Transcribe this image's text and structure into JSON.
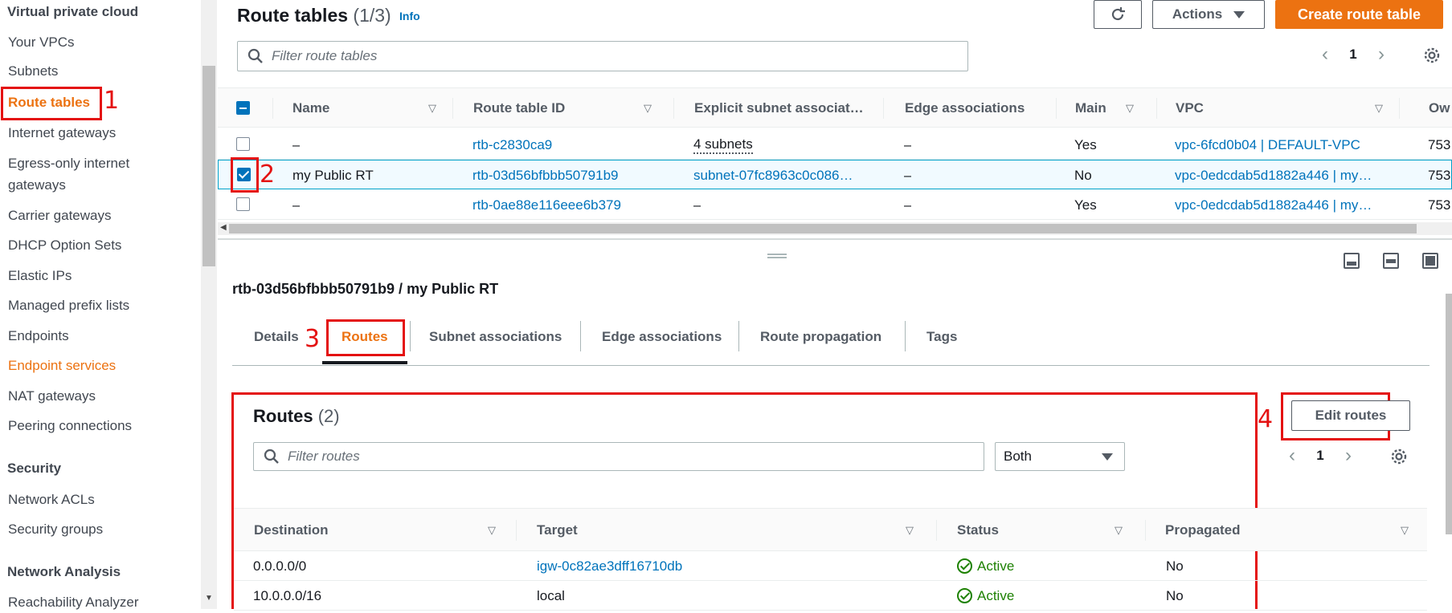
{
  "sidebar": {
    "section_vpc": "Virtual private cloud",
    "items": [
      {
        "label": "Your VPCs"
      },
      {
        "label": "Subnets"
      },
      {
        "label": "Route tables"
      },
      {
        "label": "Internet gateways"
      },
      {
        "label": "Egress-only internet"
      },
      {
        "label": "gateways"
      },
      {
        "label": "Carrier gateways"
      },
      {
        "label": "DHCP Option Sets"
      },
      {
        "label": "Elastic IPs"
      },
      {
        "label": "Managed prefix lists"
      },
      {
        "label": "Endpoints"
      },
      {
        "label": "Endpoint services"
      },
      {
        "label": "NAT gateways"
      },
      {
        "label": "Peering connections"
      }
    ],
    "section_security": "Security",
    "security_items": [
      {
        "label": "Network ACLs"
      },
      {
        "label": "Security groups"
      }
    ],
    "section_analysis": "Network Analysis",
    "analysis_items": [
      {
        "label": "Reachability Analyzer"
      }
    ]
  },
  "annotations": [
    "1",
    "2",
    "3",
    "4"
  ],
  "route_tables": {
    "title": "Route tables",
    "count": "(1/3)",
    "info": "Info",
    "actions_label": "Actions",
    "create_label": "Create route table",
    "filter_placeholder": "Filter route tables",
    "page": "1",
    "columns": [
      "Name",
      "Route table ID",
      "Explicit subnet associat…",
      "Edge associations",
      "Main",
      "VPC",
      "Ow"
    ],
    "rows": [
      {
        "name": "–",
        "id": "rtb-c2830ca9",
        "subnet": "4 subnets",
        "edge": "–",
        "main": "Yes",
        "vpc": "vpc-6fcd0b04 | DEFAULT-VPC",
        "owner": "753"
      },
      {
        "name": "my Public RT",
        "id": "rtb-03d56bfbbb50791b9",
        "subnet": "subnet-07fc8963c0c086…",
        "edge": "–",
        "main": "No",
        "vpc": "vpc-0edcdab5d1882a446 | my…",
        "owner": "753"
      },
      {
        "name": "–",
        "id": "rtb-0ae88e116eee6b379",
        "subnet": "–",
        "edge": "–",
        "main": "Yes",
        "vpc": "vpc-0edcdab5d1882a446 | my…",
        "owner": "753"
      }
    ]
  },
  "detail": {
    "title": "rtb-03d56bfbbb50791b9 / my Public RT",
    "tabs": [
      "Details",
      "Routes",
      "Subnet associations",
      "Edge associations",
      "Route propagation",
      "Tags"
    ],
    "routes_title": "Routes",
    "routes_count": "(2)",
    "edit_label": "Edit routes",
    "filter_placeholder": "Filter routes",
    "select_value": "Both",
    "page": "1",
    "columns": [
      "Destination",
      "Target",
      "Status",
      "Propagated"
    ],
    "rows": [
      {
        "destination": "0.0.0.0/0",
        "target": "igw-0c82ae3dff16710db",
        "status": "Active",
        "propagated": "No"
      },
      {
        "destination": "10.0.0.0/16",
        "target": "local",
        "status": "Active",
        "propagated": "No"
      }
    ]
  },
  "colors": {
    "accent": "#ec7211",
    "link": "#0073bb",
    "annotation": "#e41111",
    "success": "#1d8102"
  }
}
